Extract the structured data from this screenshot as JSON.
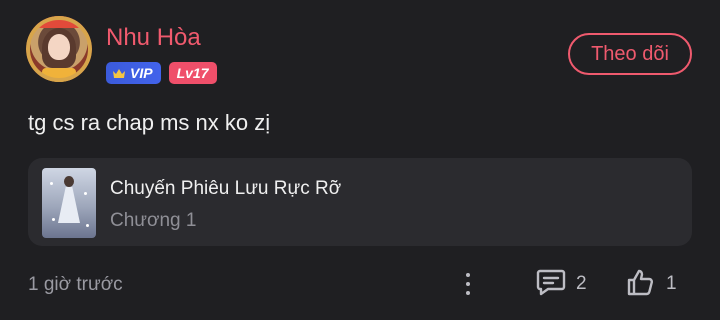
{
  "comment": {
    "author": "Nhu Hòa",
    "badges": {
      "vip_label": "VIP",
      "level_label": "Lv17"
    },
    "follow_label": "Theo dõi",
    "text": "tg cs ra chap ms nx ko zị",
    "story": {
      "title": "Chuyến Phiêu Lưu Rực Rỡ",
      "chapter": "Chương 1"
    },
    "time": "1 giờ trước",
    "reply_count": "2",
    "like_count": "1"
  },
  "icons": {
    "more": "more-vertical-icon",
    "reply": "comment-icon",
    "like": "thumbs-up-icon",
    "vip": "crown-icon"
  },
  "colors": {
    "accent": "#ef5a6e",
    "vip_badge": "#4263eb",
    "level_badge": "#ef4f6a",
    "background": "#1f1f22",
    "story_card": "#2b2b2f"
  }
}
